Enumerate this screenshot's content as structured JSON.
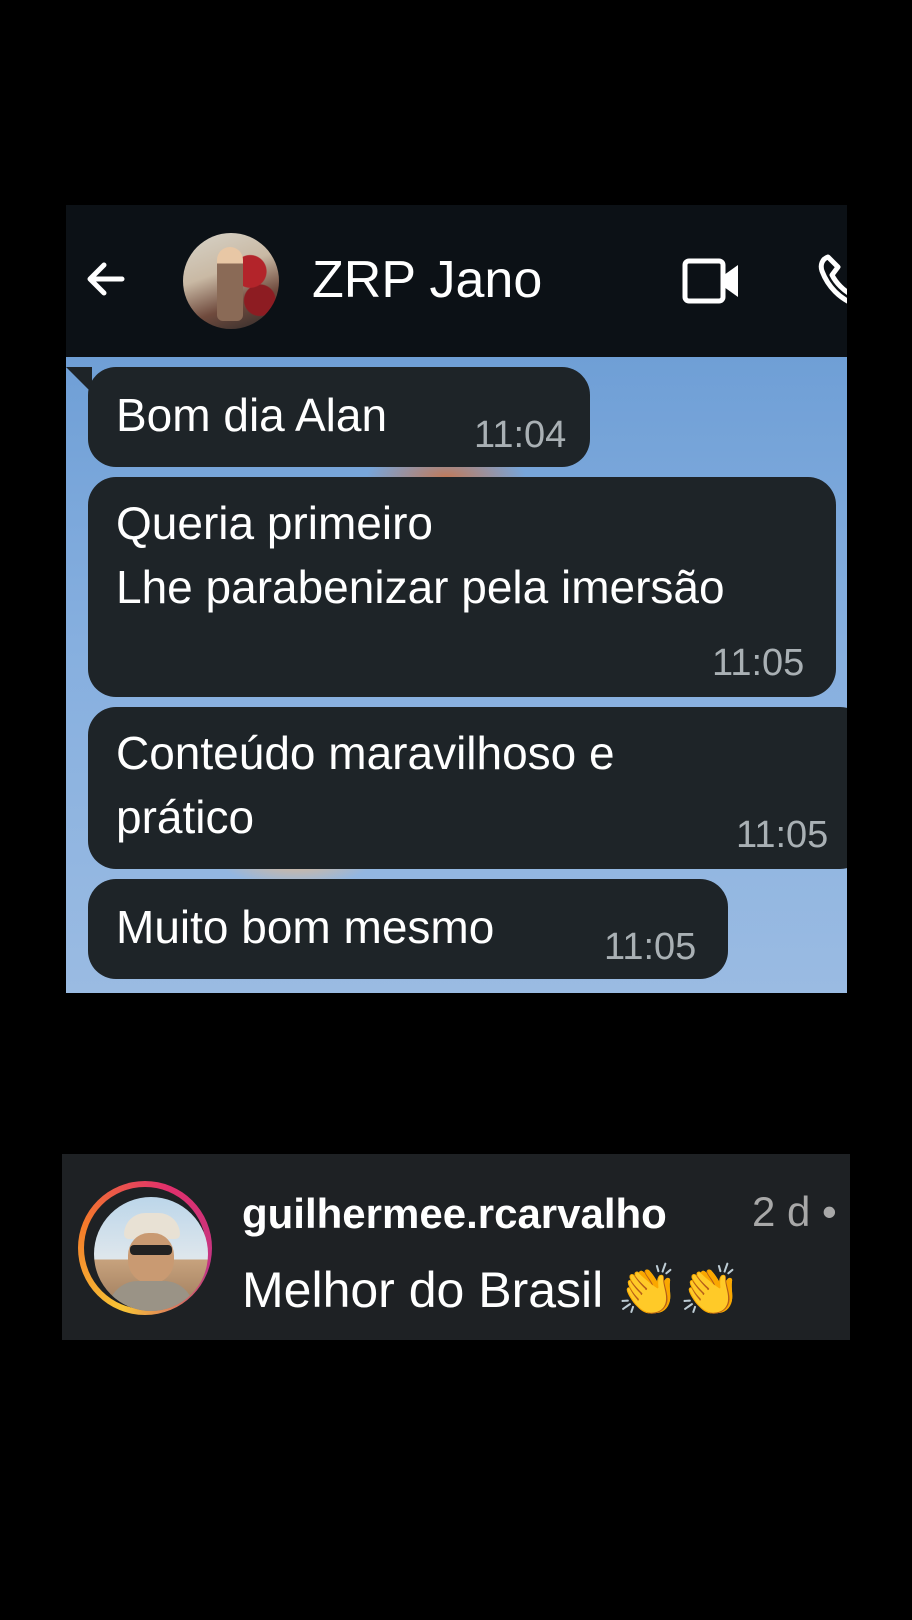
{
  "chat": {
    "contact_name": "ZRP Jano",
    "messages": [
      {
        "text": "Bom dia Alan",
        "time": "11:04"
      },
      {
        "text": "Queria primeiro\nLhe parabenizar pela imersão",
        "time": "11:05"
      },
      {
        "text": "Conteúdo maravilhoso e\nprático",
        "time": "11:05"
      },
      {
        "text": "Muito bom mesmo",
        "time": "11:05"
      }
    ]
  },
  "comment": {
    "username": "guilhermee.rcarvalho",
    "time_ago": "2 d •",
    "text": "Melhor do Brasil",
    "emoji": "👏👏"
  },
  "colors": {
    "header_bg": "#0c1116",
    "bubble_bg": "#1e2428",
    "chat_wallpaper": "#86afdf",
    "comment_bg": "#1e2124",
    "timestamp": "#a9b0b4"
  },
  "icons": [
    "back-arrow-icon",
    "video-camera-icon",
    "phone-icon",
    "clap-emoji"
  ]
}
